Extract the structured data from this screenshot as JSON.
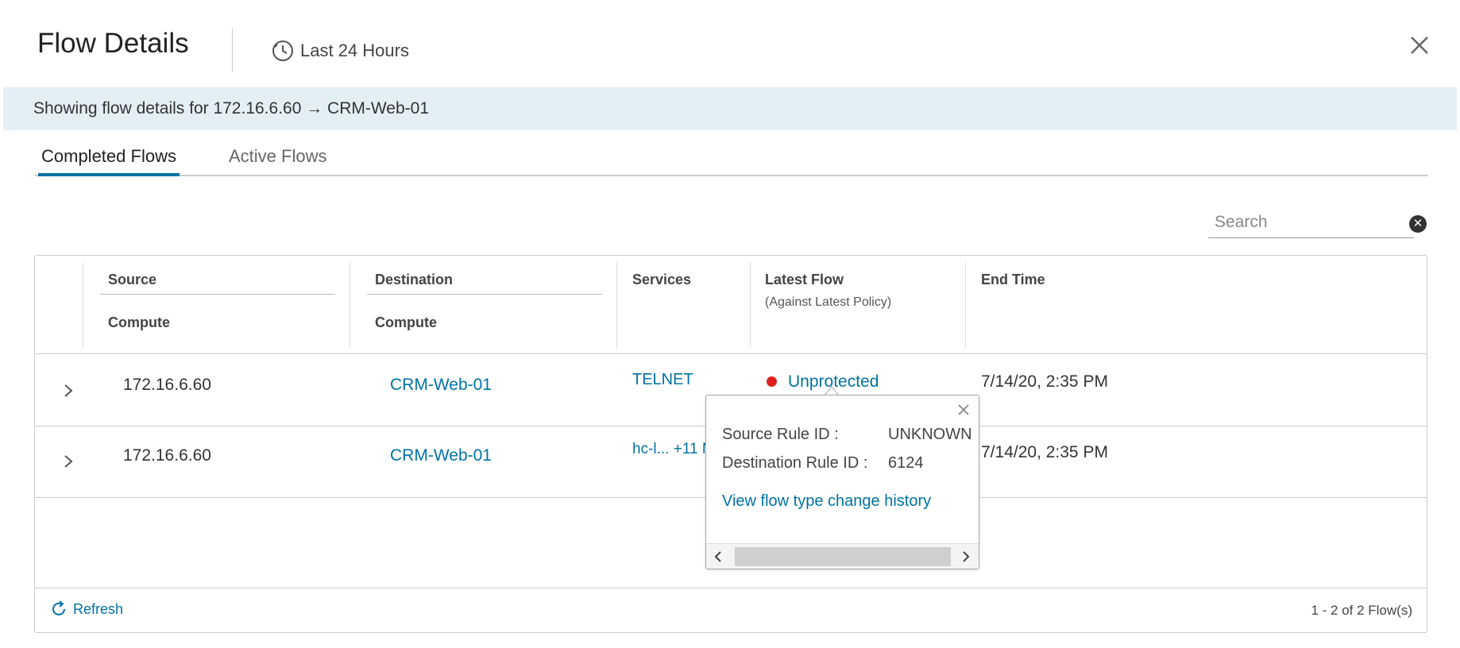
{
  "header": {
    "title": "Flow Details",
    "time_range": "Last 24 Hours"
  },
  "info_bar": {
    "text": "Showing flow details for 172.16.6.60 → CRM-Web-01"
  },
  "tabs": [
    {
      "label": "Completed Flows",
      "active": true
    },
    {
      "label": "Active Flows",
      "active": false
    }
  ],
  "search": {
    "placeholder": "Search",
    "value": ""
  },
  "table": {
    "columns": {
      "source": {
        "label": "Source",
        "sub": "Compute"
      },
      "destination": {
        "label": "Destination",
        "sub": "Compute"
      },
      "services": {
        "label": "Services"
      },
      "latest_flow": {
        "label": "Latest Flow",
        "sub": "(Against Latest Policy)"
      },
      "end_time": {
        "label": "End Time"
      }
    },
    "rows": [
      {
        "source": "172.16.6.60",
        "destination": "CRM-Web-01",
        "services": "TELNET",
        "latest_flow": "Unprotected",
        "end_time": "7/14/20, 2:35 PM"
      },
      {
        "source": "172.16.6.60",
        "destination": "CRM-Web-01",
        "services": "hc-l... +11 M",
        "end_time": "7/14/20, 2:35 PM"
      }
    ]
  },
  "popover": {
    "source_rule_label": "Source Rule ID :",
    "source_rule_value": "UNKNOWN",
    "dest_rule_label": "Destination Rule ID :",
    "dest_rule_value": "6124",
    "link": "View flow type change history"
  },
  "footer": {
    "refresh_label": "Refresh",
    "pagination": "1 - 2 of 2 Flow(s)"
  },
  "colors": {
    "accent": "#0072a3",
    "info_bar_bg": "#e3eef5",
    "status_unprotected": "#e02020"
  },
  "icons": {
    "time": "clock-icon",
    "close": "close-icon",
    "search_clear": "clear-icon",
    "expand": "chevron-right-icon",
    "refresh": "refresh-icon"
  }
}
